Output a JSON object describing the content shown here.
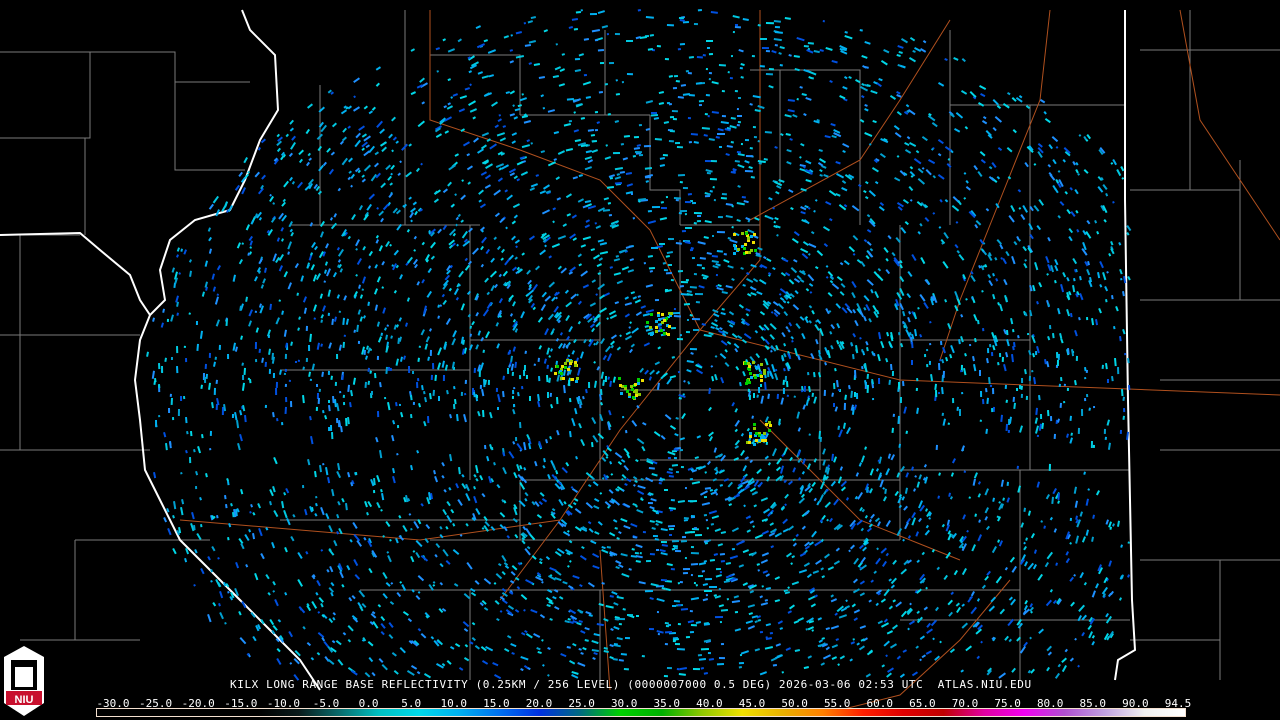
{
  "product": {
    "caption": "KILX LONG RANGE BASE REFLECTIVITY (0.25KM / 256 LEVEL) (0000007000 0.5 DEG) 2026-03-06 02:53 UTC  ATLAS.NIU.EDU"
  },
  "legend": {
    "labels": [
      "-30.0",
      "-25.0",
      "-20.0",
      "-15.0",
      "-10.0",
      "-5.0",
      "0.0",
      "5.0",
      "10.0",
      "15.0",
      "20.0",
      "25.0",
      "30.0",
      "35.0",
      "40.0",
      "45.0",
      "50.0",
      "55.0",
      "60.0",
      "65.0",
      "70.0",
      "75.0",
      "80.0",
      "85.0",
      "90.0",
      "94.5"
    ],
    "colors": [
      "#000000",
      "#000000",
      "#000000",
      "#000000",
      "#000000",
      "#0a1a1a",
      "#0a6a6a",
      "#00c0c0",
      "#00d8e8",
      "#00b0f0",
      "#0070f0",
      "#0030e0",
      "#006a80",
      "#00d000",
      "#00b000",
      "#90c800",
      "#f0e000",
      "#e8b000",
      "#ff8000",
      "#ff2000",
      "#e00000",
      "#c00000",
      "#e000a0",
      "#f000f0",
      "#b050d0",
      "#c0a0e0",
      "#f0f0f0",
      "#ffffff"
    ]
  },
  "logo": {
    "text": "NIU"
  }
}
